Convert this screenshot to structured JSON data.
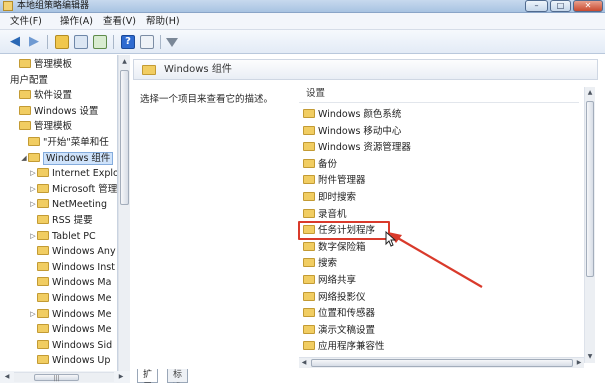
{
  "window": {
    "title": "本地组策略编辑器",
    "buttons": {
      "minimize": "–",
      "maximize": "□",
      "close": "✕"
    }
  },
  "menu": [
    "文件(F)",
    "操作(A)",
    "查看(V)",
    "帮助(H)"
  ],
  "toolbar": {
    "icons": [
      "back-arrow-icon",
      "forward-arrow-icon",
      "up-folder-icon",
      "show-hide-tree-icon",
      "export-list-icon",
      "help-icon",
      "properties-icon",
      "filter-icon"
    ],
    "help_glyph": "?"
  },
  "tree": {
    "items": [
      {
        "label": "管理模板",
        "indent": 1,
        "expander": "",
        "selected": false,
        "folder": true
      },
      {
        "label": "用户配置",
        "indent": 0,
        "expander": "",
        "selected": false,
        "folder": false
      },
      {
        "label": "软件设置",
        "indent": 1,
        "expander": "",
        "selected": false,
        "folder": true
      },
      {
        "label": "Windows 设置",
        "indent": 1,
        "expander": "",
        "selected": false,
        "folder": true
      },
      {
        "label": "管理模板",
        "indent": 1,
        "expander": "",
        "selected": false,
        "folder": true
      },
      {
        "label": "\"开始\"菜单和任",
        "indent": 2,
        "expander": "",
        "selected": false,
        "folder": true
      },
      {
        "label": "Windows 组件",
        "indent": 2,
        "expander": "◢",
        "selected": true,
        "folder": true
      },
      {
        "label": "Internet Explo",
        "indent": 3,
        "expander": "▷",
        "selected": false,
        "folder": true
      },
      {
        "label": "Microsoft 管理",
        "indent": 3,
        "expander": "▷",
        "selected": false,
        "folder": true
      },
      {
        "label": "NetMeeting",
        "indent": 3,
        "expander": "▷",
        "selected": false,
        "folder": true
      },
      {
        "label": "RSS 提要",
        "indent": 3,
        "expander": "",
        "selected": false,
        "folder": true
      },
      {
        "label": "Tablet PC",
        "indent": 3,
        "expander": "▷",
        "selected": false,
        "folder": true
      },
      {
        "label": "Windows Any",
        "indent": 3,
        "expander": "",
        "selected": false,
        "folder": true
      },
      {
        "label": "Windows Inst",
        "indent": 3,
        "expander": "",
        "selected": false,
        "folder": true
      },
      {
        "label": "Windows Ma",
        "indent": 3,
        "expander": "",
        "selected": false,
        "folder": true
      },
      {
        "label": "Windows Me",
        "indent": 3,
        "expander": "",
        "selected": false,
        "folder": true
      },
      {
        "label": "Windows Me",
        "indent": 3,
        "expander": "▷",
        "selected": false,
        "folder": true
      },
      {
        "label": "Windows Me",
        "indent": 3,
        "expander": "",
        "selected": false,
        "folder": true
      },
      {
        "label": "Windows Sid",
        "indent": 3,
        "expander": "",
        "selected": false,
        "folder": true
      },
      {
        "label": "Windows Up",
        "indent": 3,
        "expander": "",
        "selected": false,
        "folder": true
      }
    ]
  },
  "main": {
    "header_title": "Windows 组件",
    "description": "选择一个项目来查看它的描述。",
    "column_header": "设置",
    "settings": [
      "Windows 颜色系统",
      "Windows 移动中心",
      "Windows 资源管理器",
      "备份",
      "附件管理器",
      "即时搜索",
      "录音机",
      "任务计划程序",
      "数字保险箱",
      "搜索",
      "网络共享",
      "网络投影仪",
      "位置和传感器",
      "演示文稿设置",
      "应用程序兼容性"
    ],
    "highlighted_index": 7
  },
  "tabs": [
    "扩展",
    "标准"
  ],
  "scroll": {
    "left": "▲",
    "down": "▼",
    "lh": "◀",
    "rh": "▶",
    "grip": "|||"
  },
  "colors": {
    "highlight_red": "#d93a2b",
    "selection_blue": "#cfe3fb"
  }
}
